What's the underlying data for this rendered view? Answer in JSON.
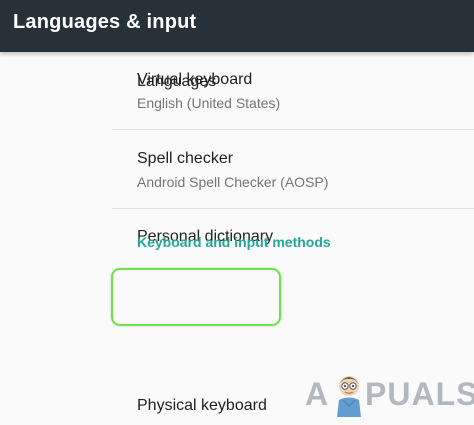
{
  "app_bar": {
    "title": "Languages & input"
  },
  "items": {
    "languages": {
      "title": "Languages",
      "summary": "English (United States)"
    },
    "spell_checker": {
      "title": "Spell checker",
      "summary": "Android Spell Checker (AOSP)"
    },
    "personal_dictionary": {
      "title": "Personal dictionary"
    },
    "virtual_keyboard": {
      "title": "Virtual keyboard"
    },
    "physical_keyboard": {
      "title": "Physical keyboard"
    }
  },
  "section": {
    "keyboard_category": "Keyboard and input methods"
  },
  "watermark": {
    "prefix": "A",
    "suffix": "PUALS"
  },
  "colors": {
    "app_bar": "#263238",
    "accent": "#26a69a",
    "highlight": "#6fe04a"
  }
}
